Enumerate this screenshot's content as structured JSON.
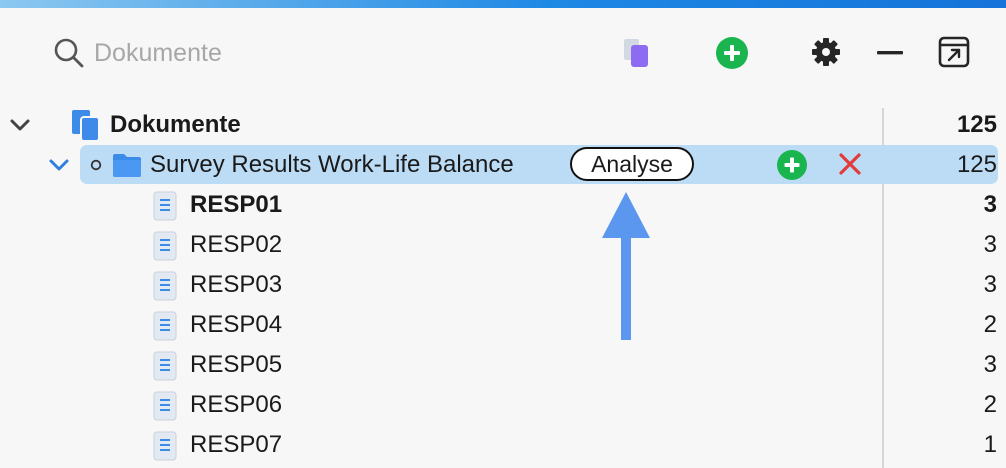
{
  "search": {
    "placeholder": "Dokumente"
  },
  "toolbar": {
    "icons": [
      "document-set-icon",
      "add-icon",
      "gear-icon",
      "minimize-icon",
      "open-window-icon"
    ]
  },
  "tree": {
    "root": {
      "label": "Dokumente",
      "count": "125"
    },
    "group": {
      "label": "Survey Results Work-Life Balance",
      "badge": "Analyse",
      "count": "125"
    },
    "documents": [
      {
        "label": "RESP01",
        "count": "3"
      },
      {
        "label": "RESP02",
        "count": "3"
      },
      {
        "label": "RESP03",
        "count": "3"
      },
      {
        "label": "RESP04",
        "count": "2"
      },
      {
        "label": "RESP05",
        "count": "3"
      },
      {
        "label": "RESP06",
        "count": "2"
      },
      {
        "label": "RESP07",
        "count": "1"
      }
    ]
  },
  "colors": {
    "accent": "#1e88e5",
    "selection": "#bcdcf6",
    "add_green": "#1ab54e",
    "delete_red": "#e23b3b",
    "folder_blue": "#3d8be8",
    "annotation_arrow": "#5b97ee"
  }
}
